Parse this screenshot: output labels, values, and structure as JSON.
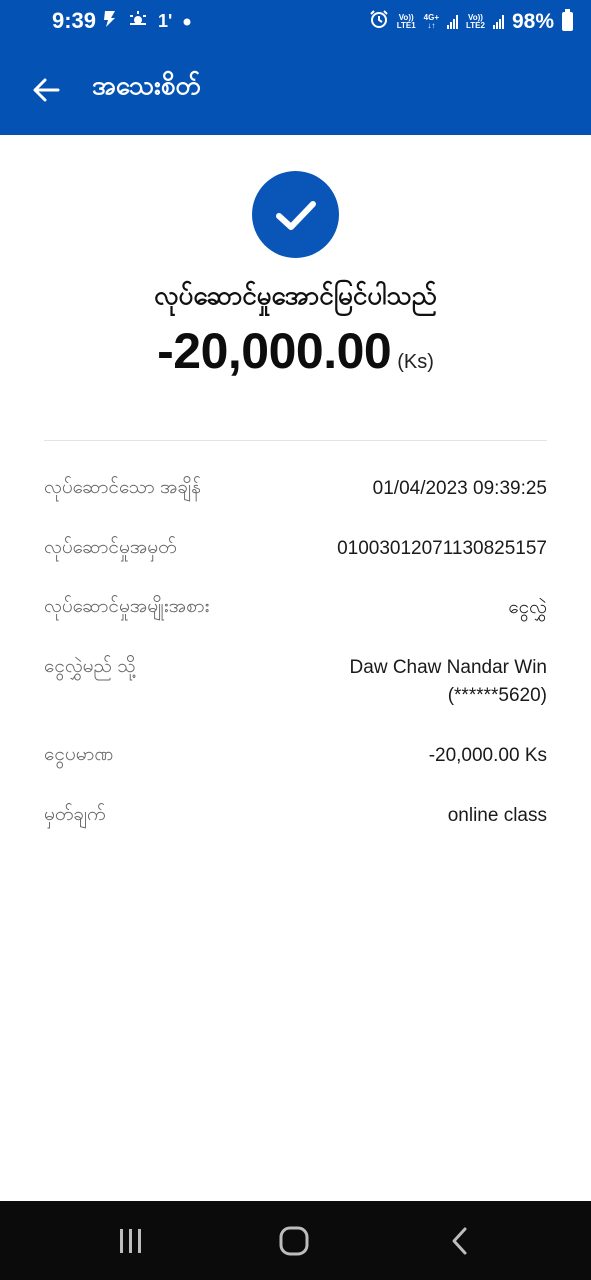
{
  "status_bar": {
    "time": "9:39",
    "left_extra": "1'",
    "lte1_top": "Vo))",
    "lte1_bottom": "LTE1",
    "net_top": "4G+",
    "net_bottom": "↓↑",
    "lte2_top": "Vo))",
    "lte2_bottom": "LTE2",
    "battery": "98%",
    "icons": [
      "messenger-icon",
      "weather-icon",
      "dot-icon",
      "alarm-icon",
      "signal-icon",
      "battery-icon"
    ]
  },
  "header": {
    "title": "အသေးစိတ်",
    "back_icon": "arrow-left-icon",
    "color": "#0552b5"
  },
  "result": {
    "icon": "check-icon",
    "message": "လုပ်ဆောင်မှုအောင်မြင်ပါသည်",
    "amount": "-20,000.00",
    "currency": "(Ks)"
  },
  "details": [
    {
      "label": "လုပ်ဆောင်သော အချိန်",
      "value": "01/04/2023 09:39:25"
    },
    {
      "label": "လုပ်ဆောင်မှုအမှတ်",
      "value": "0100301207113​0825157"
    },
    {
      "label": "လုပ်ဆောင်မှုအမျိုးအစား",
      "value": "ငွေလွှဲ"
    },
    {
      "label": "ငွေလွှဲမည် သို့",
      "value": "Daw Chaw Nandar Win",
      "value2": "(******5620)"
    },
    {
      "label": "ငွေပမာဏ",
      "value": "-20,000.00 Ks"
    },
    {
      "label": "မှတ်ချက်",
      "value": "online class"
    }
  ],
  "navigation": {
    "icons": [
      "recent-apps-icon",
      "home-icon",
      "back-icon"
    ]
  }
}
